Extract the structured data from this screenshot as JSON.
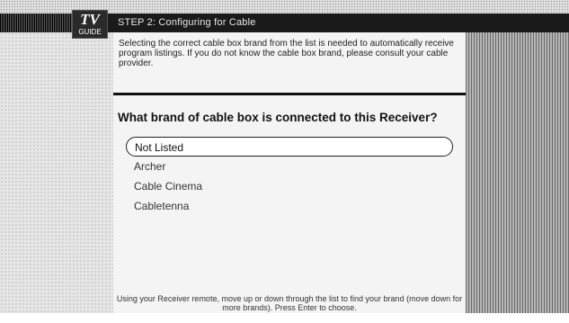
{
  "header": {
    "logo_main": "TV",
    "logo_sub": "GUIDE",
    "step_title": "STEP 2: Configuring for Cable"
  },
  "intro_text": "Selecting the correct cable box brand from the list is needed to automatically receive program listings. If you do not know the cable box brand, please consult your cable provider.",
  "question": "What brand of cable box is connected to this Receiver?",
  "brand_list": {
    "items": [
      {
        "label": "Not Listed",
        "selected": true
      },
      {
        "label": "Archer",
        "selected": false
      },
      {
        "label": "Cable Cinema",
        "selected": false
      },
      {
        "label": "Cabletenna",
        "selected": false
      }
    ]
  },
  "footer_text": "Using your Receiver remote, move up or down through the list to find your brand (move down for more brands). Press Enter to choose."
}
